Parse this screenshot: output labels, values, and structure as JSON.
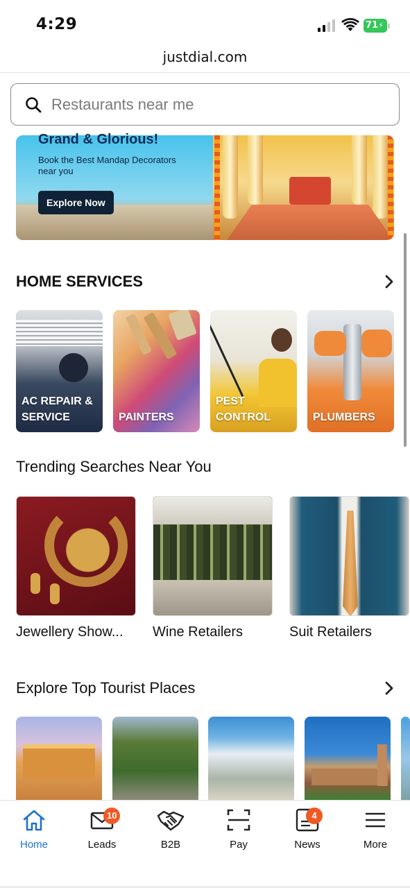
{
  "status_bar": {
    "time": "4:29",
    "battery": "71"
  },
  "browser": {
    "url": "justdial.com"
  },
  "search": {
    "placeholder": "Restaurants near me",
    "icon": "search-icon"
  },
  "banner": {
    "title": "Grand & Glorious!",
    "subtitle": "Book the Best Mandap Decorators near you",
    "button": "Explore Now"
  },
  "home_services": {
    "title": "HOME SERVICES",
    "items": [
      {
        "label": "AC REPAIR & SERVICE"
      },
      {
        "label": "PAINTERS"
      },
      {
        "label": "PEST CONTROL"
      },
      {
        "label": "PLUMBERS"
      }
    ]
  },
  "trending": {
    "title": "Trending Searches Near You",
    "items": [
      {
        "label": "Jewellery Show..."
      },
      {
        "label": "Wine Retailers"
      },
      {
        "label": "Suit Retailers"
      }
    ]
  },
  "tourist": {
    "title": "Explore Top Tourist Places"
  },
  "nav": {
    "items": [
      {
        "label": "Home",
        "icon": "home-icon",
        "active": true
      },
      {
        "label": "Leads",
        "icon": "mail-icon",
        "badge": "10"
      },
      {
        "label": "B2B",
        "icon": "handshake-icon"
      },
      {
        "label": "Pay",
        "icon": "scan-icon"
      },
      {
        "label": "News",
        "icon": "news-icon",
        "badge": "4"
      },
      {
        "label": "More",
        "icon": "menu-icon"
      }
    ]
  },
  "colors": {
    "accent": "#1f6fd1",
    "badge": "#ef5a24",
    "banner_title": "#0f2b57"
  }
}
